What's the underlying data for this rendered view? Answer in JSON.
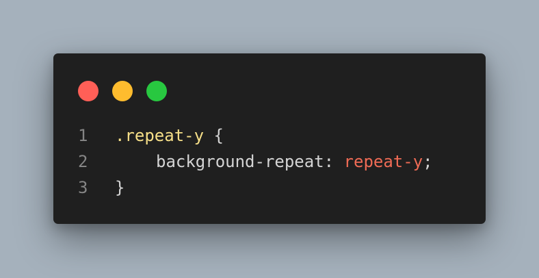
{
  "window": {
    "controls": [
      {
        "name": "close",
        "color": "#ff5f57"
      },
      {
        "name": "minimize",
        "color": "#febc2e"
      },
      {
        "name": "maximize",
        "color": "#28c840"
      }
    ]
  },
  "code": {
    "lines": [
      {
        "number": "1",
        "selector": ".repeat-y",
        "open_brace": " {"
      },
      {
        "number": "2",
        "property": "background-repeat",
        "colon": ": ",
        "value": "repeat-y",
        "semicolon": ";"
      },
      {
        "number": "3",
        "close_brace": "}"
      }
    ]
  }
}
